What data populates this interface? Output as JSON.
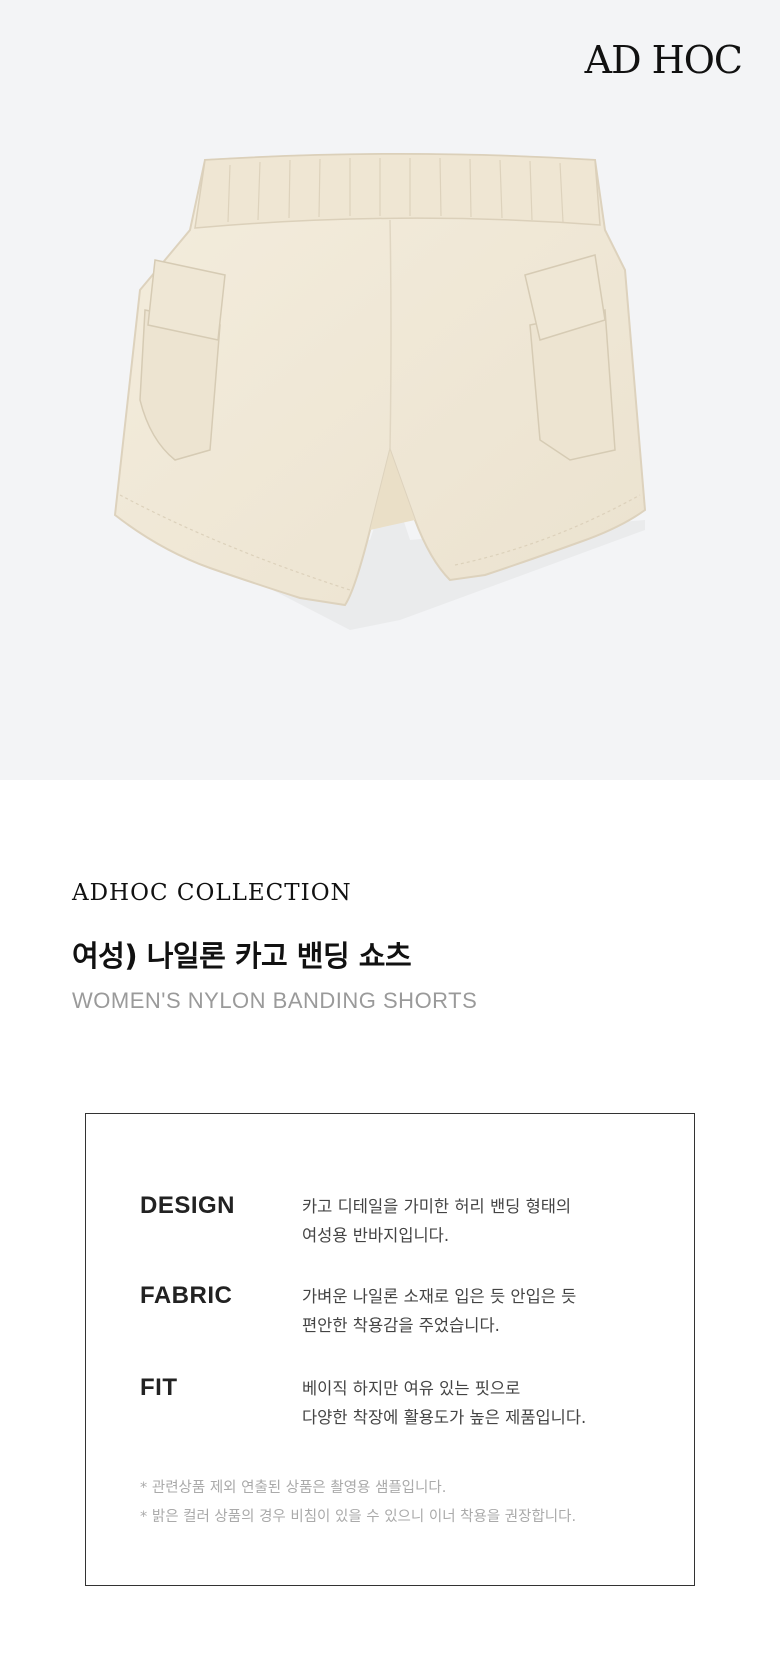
{
  "brand": {
    "logo_text": "AD HOC"
  },
  "product": {
    "image_alt": "cream nylon cargo shorts with elastic waistband",
    "colors": {
      "fabric": "#f1e9d8",
      "shadow": "#d9cfbb",
      "background": "#f3f4f6"
    }
  },
  "collection_label": "ADHOC COLLECTION",
  "title_ko": "여성) 나일론 카고 밴딩 쇼츠",
  "title_en": "WOMEN'S NYLON BANDING SHORTS",
  "info": {
    "rows": [
      {
        "label": "DESIGN",
        "lines": [
          "카고 디테일을 가미한 허리 밴딩 형태의",
          "여성용 반바지입니다."
        ]
      },
      {
        "label": "FABRIC",
        "lines": [
          "가벼운 나일론 소재로 입은 듯 안입은 듯",
          "편안한 착용감을 주었습니다."
        ]
      },
      {
        "label": "FIT",
        "lines": [
          "베이직 하지만 여유 있는 핏으로",
          "다양한 착장에 활용도가 높은 제품입니다."
        ]
      }
    ],
    "notes": [
      "* 관련상품 제외 연출된 상품은 촬영용 샘플입니다.",
      "* 밝은 컬러 상품의 경우 비침이 있을 수 있으니 이너 착용을 권장합니다."
    ]
  }
}
